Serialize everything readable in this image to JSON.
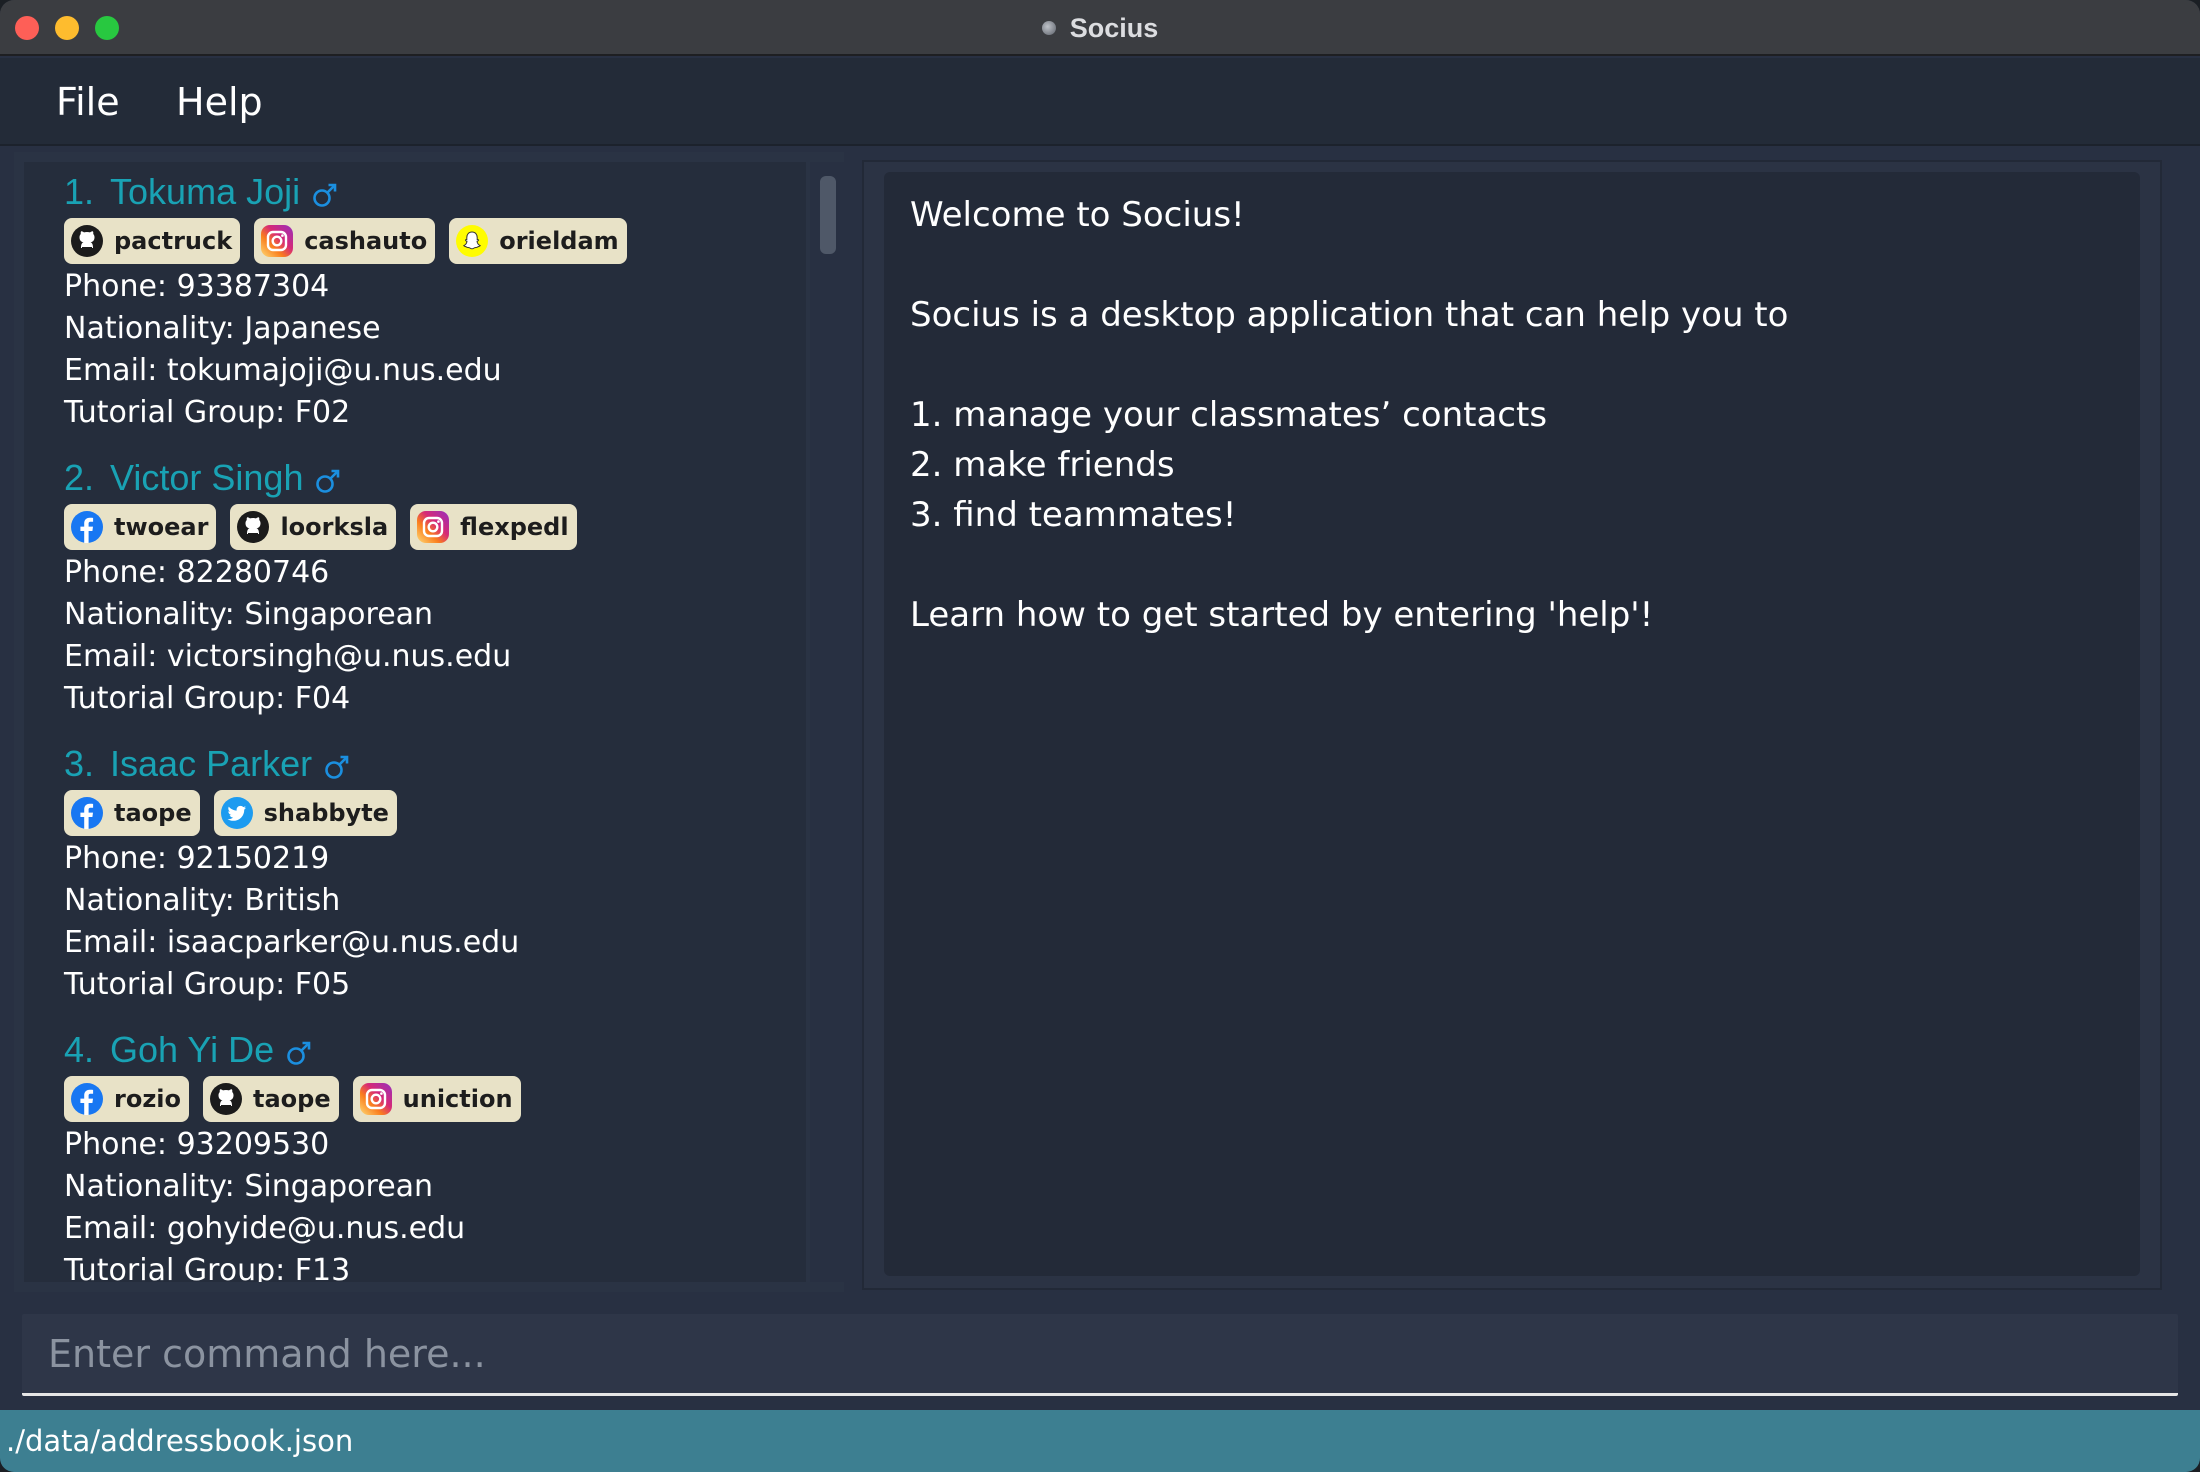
{
  "window": {
    "title": "Socius"
  },
  "menu": {
    "file": "File",
    "help": "Help"
  },
  "persons": [
    {
      "index": "1.",
      "name": "Tokuma Joji",
      "socials": [
        {
          "platform": "github-icon",
          "handle": "pactruck"
        },
        {
          "platform": "instagram-icon",
          "handle": "cashauto"
        },
        {
          "platform": "snapchat-icon",
          "handle": "orieldam"
        }
      ],
      "phone": "Phone: 93387304",
      "nationality": "Nationality: Japanese",
      "email": "Email: tokumajoji@u.nus.edu",
      "tutorial": "Tutorial Group: F02"
    },
    {
      "index": "2.",
      "name": "Victor Singh",
      "socials": [
        {
          "platform": "facebook-icon",
          "handle": "twoear"
        },
        {
          "platform": "github-icon",
          "handle": "loorksla"
        },
        {
          "platform": "instagram-icon",
          "handle": "flexpedl"
        }
      ],
      "phone": "Phone: 82280746",
      "nationality": "Nationality: Singaporean",
      "email": "Email: victorsingh@u.nus.edu",
      "tutorial": "Tutorial Group: F04"
    },
    {
      "index": "3.",
      "name": "Isaac Parker",
      "socials": [
        {
          "platform": "facebook-icon",
          "handle": "taope"
        },
        {
          "platform": "twitter-icon",
          "handle": "shabbyte"
        }
      ],
      "phone": "Phone: 92150219",
      "nationality": "Nationality: British",
      "email": "Email: isaacparker@u.nus.edu",
      "tutorial": "Tutorial Group: F05"
    },
    {
      "index": "4.",
      "name": "Goh Yi De",
      "socials": [
        {
          "platform": "facebook-icon",
          "handle": "rozio"
        },
        {
          "platform": "github-icon",
          "handle": "taope"
        },
        {
          "platform": "instagram-icon",
          "handle": "uniction"
        }
      ],
      "phone": "Phone: 93209530",
      "nationality": "Nationality: Singaporean",
      "email": "Email: gohyide@u.nus.edu",
      "tutorial": "Tutorial Group: F13"
    }
  ],
  "result": {
    "lines": [
      "Welcome to Socius!",
      "",
      "Socius is a desktop application that can help you to",
      "",
      "1. manage your classmates’ contacts",
      "2. make friends",
      "3. find teammates!",
      "",
      "Learn how to get started by entering 'help'!"
    ]
  },
  "command": {
    "placeholder": "Enter command here...",
    "value": ""
  },
  "status": {
    "path": "./data/addressbook.json"
  },
  "colors": {
    "accent": "#19a2b4",
    "tag_bg": "#e8e2c7",
    "status_bar": "#3d7f91",
    "panel_bg": "#252d3c"
  }
}
